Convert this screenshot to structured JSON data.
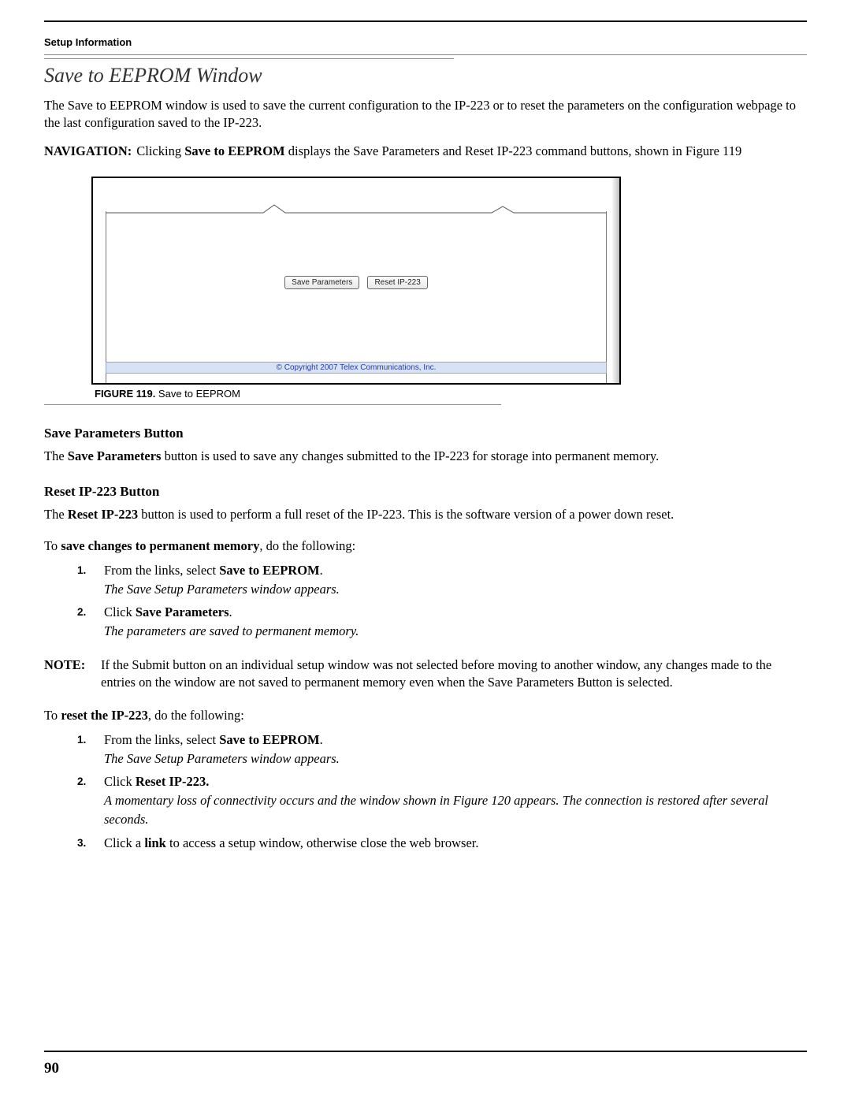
{
  "header": {
    "setup_info": "Setup Information"
  },
  "section": {
    "title": "Save to EEPROM Window",
    "intro": " The Save to EEPROM window is used to save the current configuration to the IP-223 or to reset the parameters on the configuration webpage to the last configuration saved to the IP-223."
  },
  "navigation": {
    "label": "NAVIGATION:",
    "text_prefix": "  Clicking ",
    "bold1": "Save to EEPROM",
    "text_suffix": " displays the Save Parameters and Reset IP-223 command buttons, shown in Figure 119"
  },
  "figure": {
    "save_btn": "Save Parameters",
    "reset_btn": "Reset IP-223",
    "copyright": "© Copyright 2007 Telex Communications, Inc.",
    "caption_label": "FIGURE 119.",
    "caption_text": "  Save to EEPROM"
  },
  "save_params_section": {
    "heading": "Save Parameters Button",
    "text_prefix": "The ",
    "bold": "Save Parameters",
    "text_suffix": " button is used to save any changes submitted to the IP-223 for storage into permanent memory."
  },
  "reset_section": {
    "heading": "Reset IP-223 Button",
    "text_prefix": "The ",
    "bold": "Reset IP-223",
    "text_suffix": " button is used to perform a full reset of the IP-223. This is the software version of a power down reset."
  },
  "save_proc": {
    "lead_pre": "To ",
    "lead_bold": "save changes to permanent memory",
    "lead_post": ", do the following:",
    "s1_pre": "From the links, select ",
    "s1_bold": "Save to EEPROM",
    "s1_post": ".",
    "s1_result": "The Save Setup Parameters window appears.",
    "s2_pre": "Click ",
    "s2_bold": "Save Parameters",
    "s2_post": ".",
    "s2_result": "The parameters are saved to permanent memory."
  },
  "note": {
    "label": "NOTE:",
    "text": "If the Submit button on an individual setup window was not selected before moving to another window, any changes made to the entries on the window are not saved to permanent memory even when the Save Parameters Button is selected."
  },
  "reset_proc": {
    "lead_pre": "To ",
    "lead_bold": "reset the IP-223",
    "lead_post": ", do the following:",
    "s1_pre": "From the links, select ",
    "s1_bold": "Save to EEPROM",
    "s1_post": ".",
    "s1_result": "The Save Setup Parameters window appears.",
    "s2_pre": "Click ",
    "s2_bold": "Reset IP-223.",
    "s2_result": "A momentary loss of connectivity occurs and the window shown in Figure 120 appears. The connection is restored after several seconds.",
    "s3_pre": "Click a ",
    "s3_bold": "link",
    "s3_post": " to access a setup window, otherwise close the web browser."
  },
  "page_number": "90"
}
